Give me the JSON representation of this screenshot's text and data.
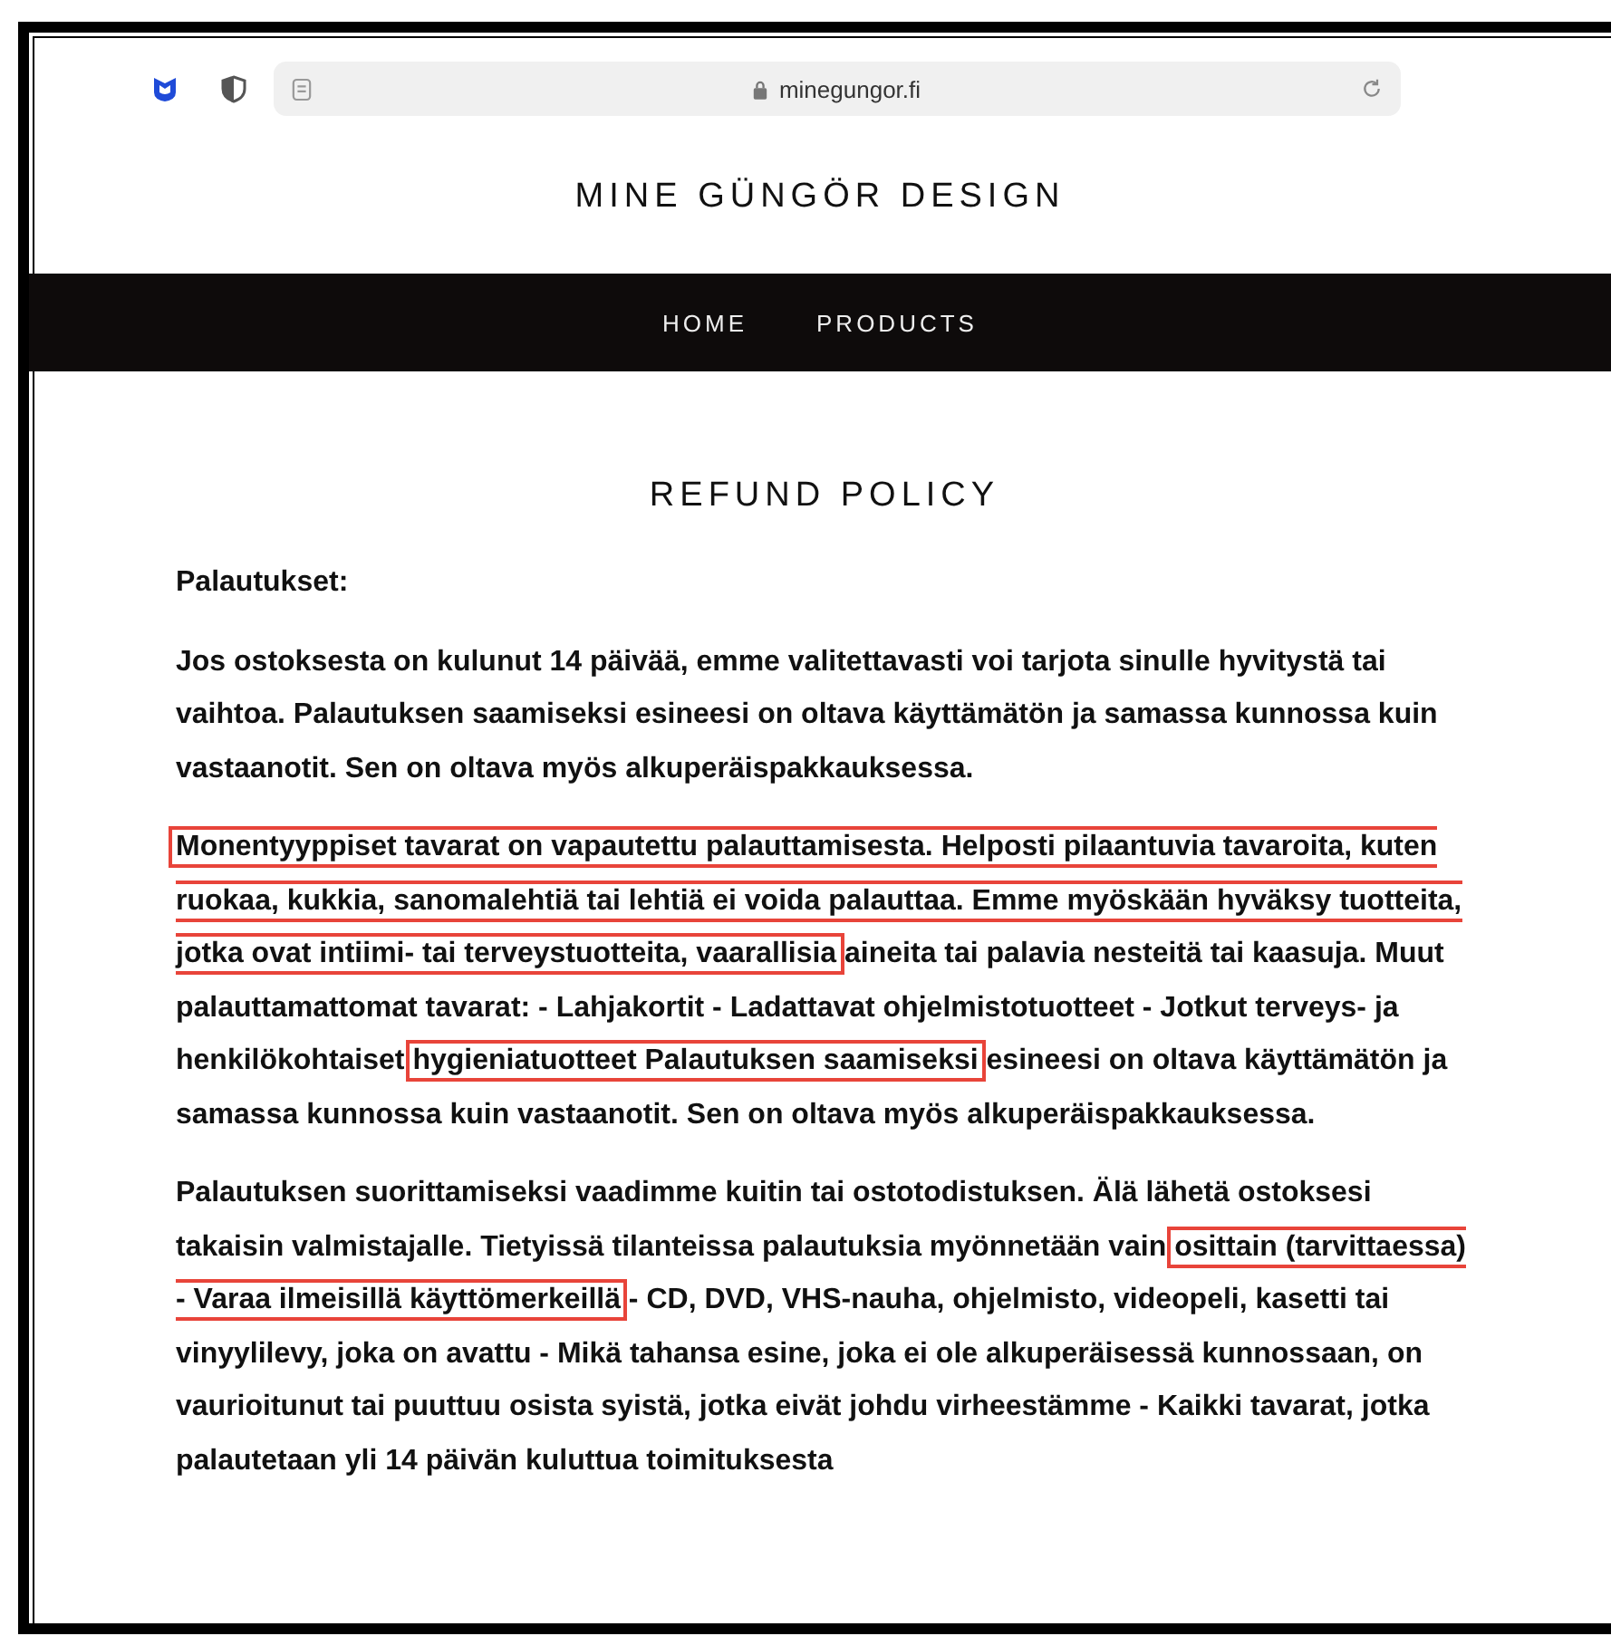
{
  "browser": {
    "url": "minegungor.fi"
  },
  "site": {
    "title": "MINE GÜNGÖR DESIGN"
  },
  "nav": [
    {
      "label": "HOME"
    },
    {
      "label": "PRODUCTS"
    }
  ],
  "page": {
    "heading": "REFUND POLICY",
    "paragraphs": [
      {
        "segments": [
          {
            "text": "Palautukset:",
            "highlighted": false
          }
        ]
      },
      {
        "segments": [
          {
            "text": "Jos ostoksesta on kulunut 14 päivää, emme valitettavasti voi tarjota sinulle hyvitystä tai vaihtoa. Palautuksen saamiseksi esineesi on oltava käyttämätön ja samassa kunnossa kuin vastaanotit. Sen on oltava myös alkuperäispakkauksessa.",
            "highlighted": false
          }
        ]
      },
      {
        "segments": [
          {
            "text": "Monentyyppiset tavarat on vapautettu palauttamisesta. Helposti pilaantuvia tavaroita, kuten ruokaa, kukkia, sanomalehtiä tai lehtiä ei voida palauttaa. Emme myöskään hyväksy tuotteita, jotka ovat intiimi- tai terveystuotteita, vaarallisia",
            "highlighted": true
          },
          {
            "text": " aineita tai palavia nesteitä tai kaasuja. Muut palauttamattomat tavarat: - Lahjakortit - Ladattavat ohjelmistotuotteet - Jotkut terveys- ja henkilökohtaiset ",
            "highlighted": false
          },
          {
            "text": "hygieniatuotteet Palautuksen saamiseksi",
            "highlighted": true
          },
          {
            "text": " esineesi on oltava käyttämätön ja samassa kunnossa kuin vastaanotit. Sen on oltava myös alkuperäispakkauksessa.",
            "highlighted": false
          }
        ]
      },
      {
        "segments": [
          {
            "text": "Palautuksen suorittamiseksi vaadimme kuitin tai ostotodistuksen. Älä lähetä ostoksesi takaisin valmistajalle. Tietyissä tilanteissa palautuksia myönnetään vain ",
            "highlighted": false
          },
          {
            "text": "osittain (tarvittaessa) - Varaa ilmeisillä käyttömerkeillä",
            "highlighted": true
          },
          {
            "text": " - CD, DVD, VHS-nauha, ohjelmisto, videopeli, kasetti tai vinyylilevy, joka on avattu - Mikä tahansa esine, joka ei ole alkuperäisessä kunnossaan, on vaurioitunut tai puuttuu osista syistä, jotka eivät johdu virheestämme - Kaikki tavarat, jotka palautetaan yli 14 päivän kuluttua toimituksesta",
            "highlighted": false
          }
        ]
      }
    ]
  }
}
